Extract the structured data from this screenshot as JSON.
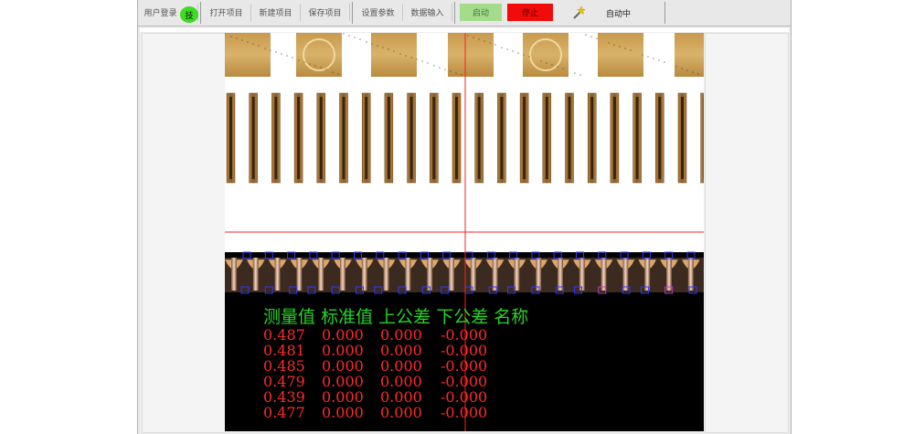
{
  "toolbar": {
    "login": "用户登录",
    "login_badge": "技",
    "open_project": "打开项目",
    "new_project": "新建项目",
    "save_project": "保存项目",
    "settings": "设置参数",
    "data_input": "数据输入",
    "start": "启动",
    "stop": "停止",
    "wand_icon": "magic-wand-icon",
    "status": "自动中"
  },
  "colors": {
    "start_bg": "#a4dc8c",
    "stop_bg": "#f20b0b",
    "badge_bg": "#3cdc23",
    "header_text": "#26d226",
    "value_text": "#ff2a2a",
    "crosshair": "#ff2020",
    "roi_box": "#2f3cff"
  },
  "results": {
    "headers": [
      "测量值",
      "标准值",
      "上公差",
      "下公差",
      "名称"
    ],
    "rows": [
      [
        "0.487",
        "0.000",
        "0.000",
        "-0.000"
      ],
      [
        "0.481",
        "0.000",
        "0.000",
        "-0.000"
      ],
      [
        "0.485",
        "0.000",
        "0.000",
        "-0.000"
      ],
      [
        "0.479",
        "0.000",
        "0.000",
        "-0.000"
      ],
      [
        "0.439",
        "0.000",
        "0.000",
        "-0.000"
      ],
      [
        "0.477",
        "0.000",
        "0.000",
        "-0.000"
      ]
    ]
  }
}
